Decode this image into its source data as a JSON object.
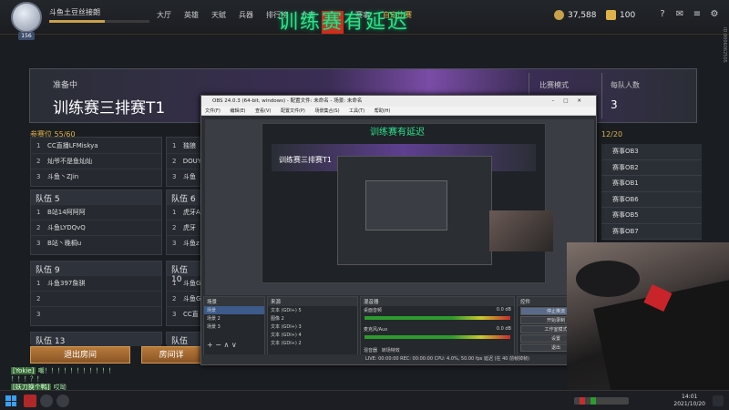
{
  "user": {
    "name": "斗鱼土豆丝接朗",
    "level": "156",
    "xp_fraction": 0.55
  },
  "nav": [
    "大厅",
    "英雄",
    "天赋",
    "兵器",
    "排行榜",
    "仓库",
    "商城",
    "赛事",
    "自定比赛"
  ],
  "stream_banner": {
    "part1": "训练",
    "mark": "赛",
    "part2": "有延迟"
  },
  "currency": {
    "gold": "37,588",
    "coupon": "100"
  },
  "room": {
    "status": "准备中",
    "title": "训练赛三排赛T1",
    "mode_label": "比赛模式",
    "team_size_label": "每队人数",
    "team_size": "3"
  },
  "seats": {
    "label": "参赛位 55/60",
    "observers": "12/20"
  },
  "teams": [
    {
      "name": "",
      "members": [
        "CC直播LFMiskya",
        "灿爷不是鱼灿灿",
        "斗鱼丶ZJin"
      ]
    },
    {
      "name": "",
      "members": [
        "独狼",
        "DOUY",
        "斗鱼"
      ]
    },
    {
      "name": "队伍 5",
      "members": [
        "B站14阿阿阿",
        "斗鱼LYDQvQ",
        "B站丶晚桐u"
      ]
    },
    {
      "name": "队伍 6",
      "members": [
        "虎牙A",
        "虎牙",
        "斗鱼z"
      ]
    },
    {
      "name": "队伍 9",
      "members": [
        "斗鱼397詹骐",
        "",
        ""
      ]
    },
    {
      "name": "队伍 10",
      "members": [
        "斗鱼G",
        "斗鱼G",
        "CC直"
      ]
    }
  ],
  "extra_teams": [
    "队伍 13",
    "队伍"
  ],
  "observers": [
    "赛事OB3",
    "赛事OB2",
    "赛事OB1",
    "赛事OB6",
    "赛事OB5",
    "赛事OB7"
  ],
  "buttons": {
    "leave": "退出房间",
    "detail": "房间详"
  },
  "chat": [
    {
      "tag": "[Yokie]",
      "text": "嘲！！！！！！！！！！！"
    },
    {
      "tag": "",
      "text": "！！！？！"
    },
    {
      "tag": "[妖刀换个鸭]",
      "text": "哎呦"
    }
  ],
  "obs": {
    "title": "OBS 24.0.3 (64-bit, windows) - 配置文件: 未命名 - 场景: 未命名",
    "menu": [
      "文件(F)",
      "编辑(E)",
      "查看(V)",
      "配置文件(P)",
      "场景集合(S)",
      "工具(T)",
      "帮助(H)"
    ],
    "nested_title": "训练赛三排赛T1",
    "nested_banner": "训练赛有延迟",
    "scenes_title": "场景",
    "scenes": [
      "场景",
      "场景 2",
      "场景 3"
    ],
    "sources_title": "来源",
    "sources": [
      "文本 (GDI+) 5",
      "图像 2",
      "文本 (GDI+) 3",
      "文本 (GDI+) 4",
      "文本 (GDI+) 2"
    ],
    "mixer_title": "混音器",
    "mixer": [
      "桌面音频",
      "麦克风/Aux"
    ],
    "mixer_level": "0.0 dB",
    "mixer_tabs": [
      "混音器",
      "转场特效"
    ],
    "controls_title": "控件",
    "controls": [
      "停止推流",
      "开始录制",
      "工作室模式",
      "设置",
      "退出"
    ],
    "status": "LIVE: 00:00:00   REC: 00:00:00   CPU: 4.0%, 50.00 fps   延迟 (在 40 前帧掉帧)"
  },
  "taskbar": {
    "time": "14:01",
    "date": "2021/10/20"
  },
  "side_text": "ID:9006062505"
}
